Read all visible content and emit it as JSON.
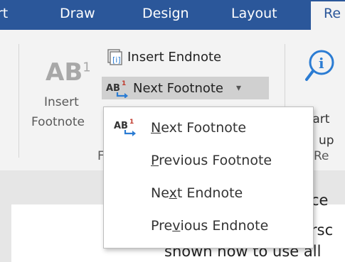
{
  "tabs": [
    {
      "label": "rt"
    },
    {
      "label": "Draw"
    },
    {
      "label": "Design"
    },
    {
      "label": "Layout"
    },
    {
      "label": "Re"
    }
  ],
  "ribbon": {
    "insert_footnote": {
      "big_icon": "AB",
      "sup": "1",
      "line1": "Insert",
      "line2": "Footnote"
    },
    "insert_endnote": {
      "icon": "endnote-icon",
      "label": "Insert Endnote"
    },
    "next_footnote": {
      "icon": "next-footnote-icon",
      "label": "Next Footnote",
      "caret": "▾"
    },
    "group_label_partial_left": "F",
    "group_label_partial_right": "Re",
    "smart_lookup": {
      "icon": "info-icon",
      "line1": "Smart",
      "line2": "up"
    }
  },
  "menu": {
    "items": [
      {
        "pre": "",
        "key": "N",
        "post": "ext Footnote",
        "icon": "next-footnote-icon"
      },
      {
        "pre": "",
        "key": "P",
        "post": "revious Footnote"
      },
      {
        "pre": "Ne",
        "key": "x",
        "post": "t Endnote"
      },
      {
        "pre": "Pre",
        "key": "v",
        "post": "ious Endnote"
      }
    ]
  },
  "document": {
    "line1": "ce",
    "line2": "rsc",
    "line3": "shown how to use all"
  },
  "colors": {
    "tabbar": "#2b579a",
    "ribbon": "#f3f3f3",
    "footnote_red": "#c0392b",
    "arrow_blue": "#2b7cd3"
  }
}
